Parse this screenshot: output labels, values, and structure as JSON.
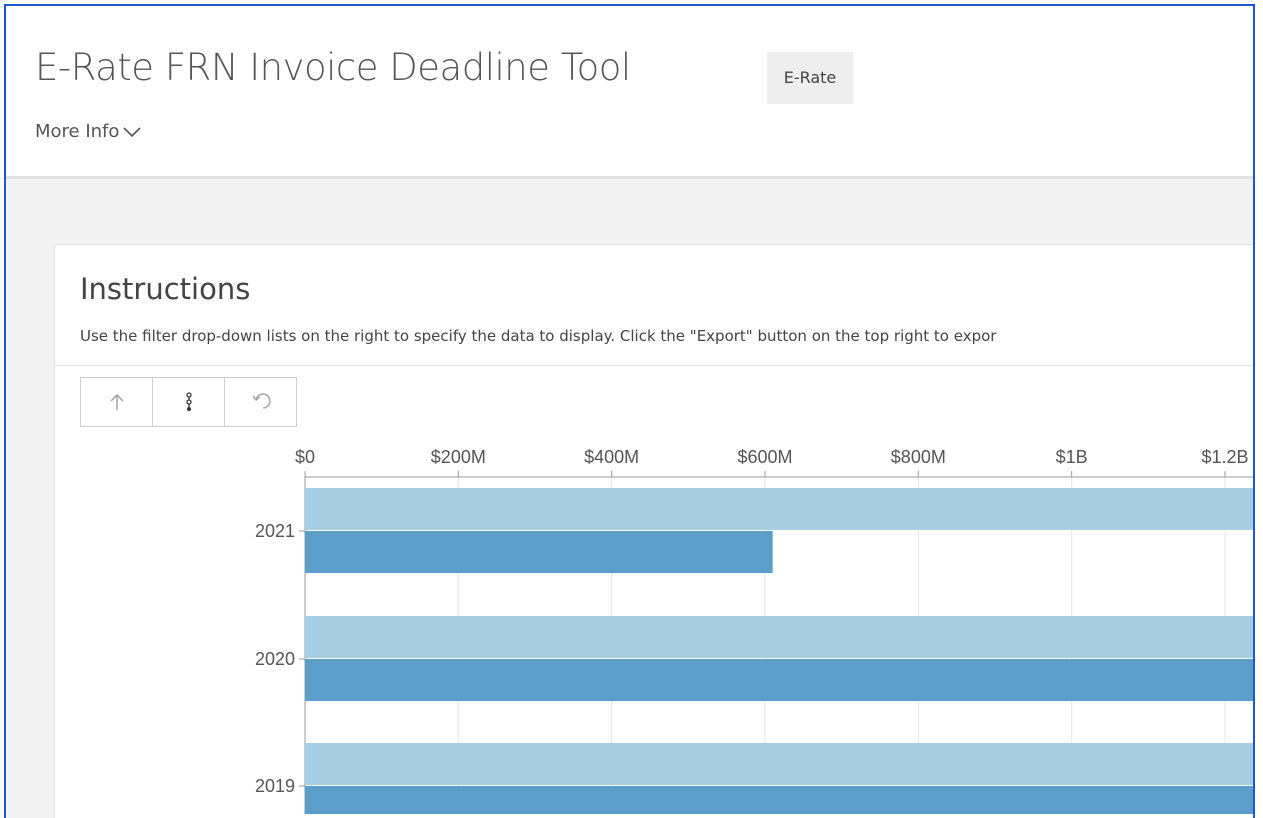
{
  "page": {
    "title": "E-Rate FRN Invoice Deadline Tool",
    "tag": "E-Rate",
    "more_info": "More Info"
  },
  "card": {
    "title": "Instructions",
    "description": "Use the filter drop-down lists on the right to specify the data to display. Click the \"Export\" button on the top right to expor"
  },
  "toolbar": {
    "icons": [
      "arrow-up-icon",
      "drill-icon",
      "undo-icon"
    ]
  },
  "colors": {
    "series_light": "#a6cde1",
    "series_dark": "#5b9ec9",
    "frame_border": "#1f55d1"
  },
  "chart_data": {
    "type": "bar",
    "orientation": "horizontal",
    "categories": [
      "2021",
      "2020",
      "2019"
    ],
    "series": [
      {
        "values": [
          1250000000,
          1250000000,
          1250000000
        ]
      },
      {
        "values": [
          610000000,
          1250000000,
          1250000000
        ]
      }
    ],
    "x_ticks": [
      "$0",
      "$200M",
      "$400M",
      "$600M",
      "$800M",
      "$1B",
      "$1.2B"
    ],
    "xlim": [
      0,
      1200000000
    ],
    "grid": true,
    "axis_position": "top"
  }
}
